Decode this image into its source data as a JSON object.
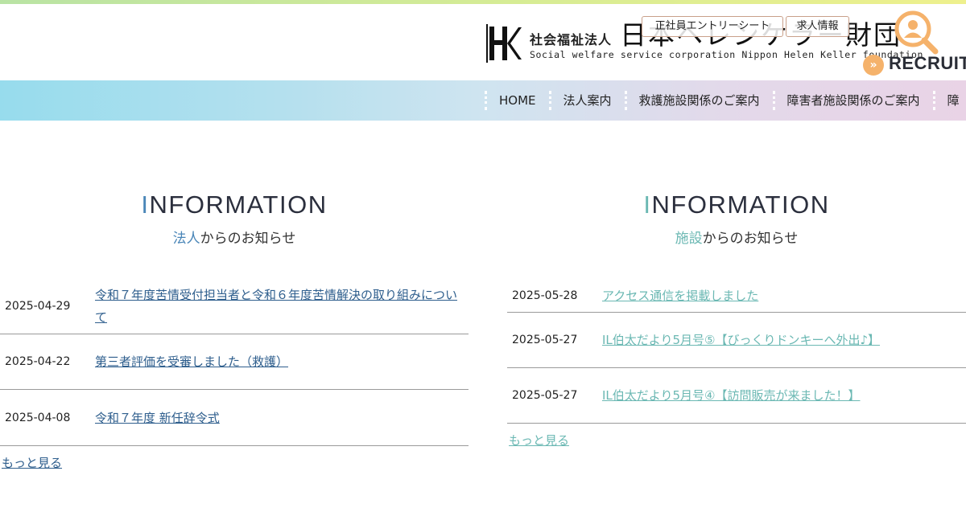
{
  "header": {
    "org_type": "社会福祉法人",
    "org_name": "日本ヘレンケラー財団",
    "org_name_en": "Social welfare service corporation Nippon Helen Keller foundation",
    "entry_sheet_label": "正社員エントリーシート",
    "job_info_label": "求人情報",
    "recruit_label": "RECRUIT",
    "recruit_icon": "person-search-icon",
    "logo_icon": "hk-logo"
  },
  "nav": {
    "items": [
      "HOME",
      "法人案内",
      "救護施設関係のご案内",
      "障害者施設関係のご案内",
      "障"
    ]
  },
  "info_left": {
    "title_cap": "I",
    "title_rest": "NFORMATION",
    "subtitle_hl": "法人",
    "subtitle_rest": "からのお知らせ",
    "items": [
      {
        "date": "2025-04-29",
        "title": "令和７年度苦情受付担当者と令和６年度苦情解決の取り組みについて"
      },
      {
        "date": "2025-04-22",
        "title": "第三者評価を受審しました（救護）"
      },
      {
        "date": "2025-04-08",
        "title": "令和７年度 新任辞令式"
      }
    ],
    "more_label": "もっと見る"
  },
  "info_right": {
    "title_cap": "I",
    "title_rest": "NFORMATION",
    "subtitle_hl": "施設",
    "subtitle_rest": "からのお知らせ",
    "items": [
      {
        "date": "2025-05-28",
        "title": "アクセス通信を掲載しました"
      },
      {
        "date": "2025-05-27",
        "title": "IL伯太だより5月号⑤【びっくりドンキーへ外出♪】"
      },
      {
        "date": "2025-05-27",
        "title": "IL伯太だより5月号④【訪問販売が来ました！】"
      }
    ],
    "more_label": "もっと見る"
  },
  "colors": {
    "accent_left": "#4a86b8",
    "accent_right": "#6bb8b3",
    "recruit_orange": "#f5b26b"
  }
}
